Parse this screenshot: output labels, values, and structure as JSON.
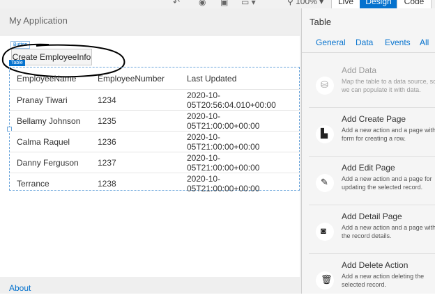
{
  "toolbar": {
    "zoom_label": "100%",
    "modes": [
      "Live",
      "Design",
      "Code"
    ],
    "active_mode": "Design",
    "icons": [
      "undo-icon",
      "preview-icon",
      "device-icon",
      "frame-icon",
      "zoom-icon"
    ]
  },
  "app": {
    "title": "My Application",
    "footer_link": "About"
  },
  "design_labels": {
    "button": "Button",
    "table": "Table"
  },
  "create_button": {
    "label": "Create EmployeeInfo"
  },
  "table": {
    "columns": [
      "EmployeeName",
      "EmployeeNumber",
      "Last Updated"
    ],
    "rows": [
      [
        "Pranay Tiwari",
        "1234",
        "2020-10-05T20:56:04.010+00:00"
      ],
      [
        "Bellamy Johnson",
        "1235",
        "2020-10-05T21:00:00+00:00"
      ],
      [
        "Calma Raquel",
        "1236",
        "2020-10-05T21:00:00+00:00"
      ],
      [
        "Danny Ferguson",
        "1237",
        "2020-10-05T21:00:00+00:00"
      ],
      [
        "Terrance",
        "1238",
        "2020-10-05T21:00:00+00:00"
      ]
    ]
  },
  "panel": {
    "title": "Table",
    "tabs": [
      "General",
      "Data",
      "Events",
      "All"
    ],
    "quick_starts": [
      {
        "title": "Add Data",
        "line1": "Map the table to a data source, so",
        "line2": "we can populate it with data.",
        "icon": "data-source-icon",
        "disabled": true
      },
      {
        "title": "Add Create Page",
        "line1": "Add a new action and a page with a",
        "line2": "form for creating a row.",
        "icon": "create-page-icon",
        "disabled": false
      },
      {
        "title": "Add Edit Page",
        "line1": "Add a new action and a page for",
        "line2": "updating the selected record.",
        "icon": "edit-page-icon",
        "disabled": false
      },
      {
        "title": "Add Detail Page",
        "line1": "Add a new action and a page with",
        "line2": "the record details.",
        "icon": "detail-page-icon",
        "disabled": false
      },
      {
        "title": "Add Delete Action",
        "line1": "Add a new action deleting the",
        "line2": "selected record.",
        "icon": "trash-icon",
        "disabled": false
      }
    ]
  },
  "colors": {
    "accent": "#0572ce",
    "annotation": "#000000"
  }
}
